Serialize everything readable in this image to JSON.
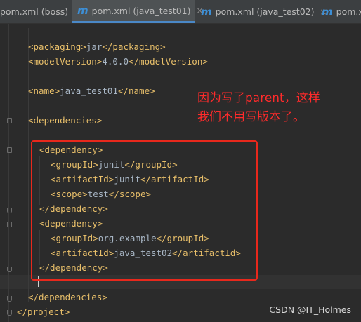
{
  "tabs": [
    {
      "label": "pom.xml (boss)",
      "active": false
    },
    {
      "label": "pom.xml (java_test01)",
      "active": true
    },
    {
      "label": "pom.xml (java_test02)",
      "active": false
    },
    {
      "label": "pom.x",
      "active": false
    }
  ],
  "tab_icon_glyph": "m",
  "tab_close_glyph": "×",
  "code_lines": [
    "<packaging>jar</packaging>",
    "<modelVersion>4.0.0</modelVersion>",
    "<name>java_test01</name>",
    "<dependencies>",
    "<dependency>",
    "<groupId>junit</groupId>",
    "<artifactId>junit</artifactId>",
    "<scope>test</scope>",
    "</dependency>",
    "<dependency>",
    "<groupId>org.example</groupId>",
    "<artifactId>java_test02</artifactId>",
    "</dependency>",
    "</dependencies>",
    "</project>"
  ],
  "annotation": {
    "line1": "因为写了parent，这样",
    "line2": "我们不用写版本了。"
  },
  "watermark": "CSDN @IT_Holmes",
  "colors": {
    "editor_bg": "#2b2b2b",
    "tag": "#e8bf6a",
    "text": "#a9b7c6",
    "annotation": "#ff2b2b",
    "highlight_box": "#e8281c",
    "tab_accent": "#4a88c7"
  }
}
